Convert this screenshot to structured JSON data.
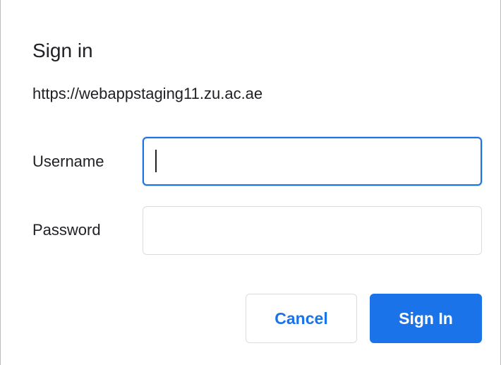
{
  "dialog": {
    "title": "Sign in",
    "url": "https://webappstaging11.zu.ac.ae"
  },
  "form": {
    "username_label": "Username",
    "username_value": "",
    "password_label": "Password",
    "password_value": ""
  },
  "buttons": {
    "cancel_label": "Cancel",
    "signin_label": "Sign In"
  },
  "colors": {
    "accent": "#1a73e8",
    "text": "#202124",
    "border": "#dadce0"
  }
}
